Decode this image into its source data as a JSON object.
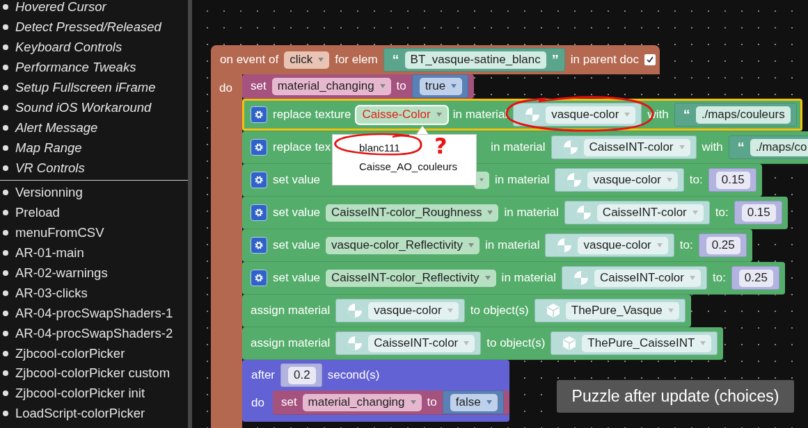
{
  "sidebar": {
    "groups": [
      {
        "items": [
          "Hovered Cursor",
          "Detect Pressed/Released",
          "Keyboard Controls",
          "Performance Tweaks",
          "Setup Fullscreen iFrame",
          "Sound iOS Workaround",
          "Alert Message",
          "Map Range",
          "VR Controls"
        ]
      },
      {
        "items": [
          "Versionning",
          "Preload",
          "menuFromCSV",
          "AR-01-main",
          "AR-02-warnings",
          "AR-03-clicks",
          "AR-04-procSwapShaders-1",
          "AR-04-procSwapShaders-2",
          "Zjbcool-colorPicker",
          "Zjbcool-colorPicker custom",
          "Zjbcool-colorPicker init",
          "LoadScript-colorPicker"
        ]
      }
    ]
  },
  "workspace": {
    "event": {
      "parts": [
        {
          "kind": "label",
          "text": "on event of"
        },
        {
          "kind": "dropdown",
          "text": "click"
        },
        {
          "kind": "label",
          "text": "for elem"
        },
        {
          "kind": "string",
          "open": "“",
          "text": "BT_vasque-satine_blanc",
          "close": "”"
        },
        {
          "kind": "label",
          "text": "in parent doc"
        },
        {
          "kind": "checkbox",
          "checked": true
        }
      ],
      "do_label": "do",
      "statements": [
        {
          "kind": "variable",
          "selected": false,
          "parts": [
            {
              "kind": "label",
              "text": "set"
            },
            {
              "kind": "dropdown",
              "text": "material_changing"
            },
            {
              "kind": "label",
              "text": "to"
            },
            {
              "kind": "bool",
              "text": "true"
            }
          ]
        },
        {
          "kind": "action",
          "selected": true,
          "parts": [
            {
              "kind": "label",
              "text": "replace texture"
            },
            {
              "kind": "dropdown",
              "text": "Caisse-Color",
              "invalid": true
            },
            {
              "kind": "label",
              "text": "in material"
            },
            {
              "kind": "material",
              "text": "vasque-color"
            },
            {
              "kind": "label",
              "text": "with"
            },
            {
              "kind": "string",
              "open": "“",
              "text": "./maps/couleurs"
            }
          ]
        },
        {
          "kind": "action",
          "selected": false,
          "parts": [
            {
              "kind": "label",
              "text": "replace tex"
            },
            {
              "kind": "covered"
            },
            {
              "kind": "label",
              "text": "in material"
            },
            {
              "kind": "material",
              "text": "CaisseINT-color"
            },
            {
              "kind": "label",
              "text": "with"
            },
            {
              "kind": "string",
              "open": "“",
              "text": "./maps/co"
            }
          ]
        },
        {
          "kind": "action",
          "selected": false,
          "parts": [
            {
              "kind": "label",
              "text": "set value"
            },
            {
              "kind": "dropdown"
            },
            {
              "kind": "label",
              "text": "in material"
            },
            {
              "kind": "material",
              "text": "vasque-color"
            },
            {
              "kind": "label",
              "text": "to:"
            },
            {
              "kind": "number",
              "text": "0.15"
            }
          ]
        },
        {
          "kind": "action",
          "selected": false,
          "parts": [
            {
              "kind": "label",
              "text": "set value"
            },
            {
              "kind": "dropdown",
              "text": "CaisseINT-color_Roughness"
            },
            {
              "kind": "label",
              "text": "in material"
            },
            {
              "kind": "material",
              "text": "CaisseINT-color"
            },
            {
              "kind": "label",
              "text": "to:"
            },
            {
              "kind": "number",
              "text": "0.15"
            }
          ]
        },
        {
          "kind": "action",
          "selected": false,
          "parts": [
            {
              "kind": "label",
              "text": "set value"
            },
            {
              "kind": "dropdown",
              "text": "vasque-color_Reflectivity"
            },
            {
              "kind": "label",
              "text": "in material"
            },
            {
              "kind": "material",
              "text": "vasque-color"
            },
            {
              "kind": "label",
              "text": "to:"
            },
            {
              "kind": "number",
              "text": "0.25"
            }
          ]
        },
        {
          "kind": "action",
          "selected": false,
          "parts": [
            {
              "kind": "label",
              "text": "set value"
            },
            {
              "kind": "dropdown",
              "text": "CaisseINT-color_Reflectivity"
            },
            {
              "kind": "label",
              "text": "in material"
            },
            {
              "kind": "material",
              "text": "CaisseINT-color"
            },
            {
              "kind": "label",
              "text": "to:"
            },
            {
              "kind": "number",
              "text": "0.25"
            }
          ]
        },
        {
          "kind": "assign",
          "selected": false,
          "parts": [
            {
              "kind": "label",
              "text": "assign material"
            },
            {
              "kind": "material",
              "text": "vasque-color"
            },
            {
              "kind": "label",
              "text": "to object(s)"
            },
            {
              "kind": "object",
              "text": "ThePure_Vasque"
            }
          ]
        },
        {
          "kind": "assign",
          "selected": false,
          "parts": [
            {
              "kind": "label",
              "text": "assign material"
            },
            {
              "kind": "material",
              "text": "CaisseINT-color"
            },
            {
              "kind": "label",
              "text": "to object(s)"
            },
            {
              "kind": "object",
              "text": "ThePure_CaisseINT"
            }
          ]
        },
        {
          "kind": "timer",
          "selected": false,
          "parts": [
            {
              "kind": "label",
              "text": "after"
            },
            {
              "kind": "number",
              "text": "0.2"
            },
            {
              "kind": "label",
              "text": "second(s)"
            }
          ],
          "do_label": "do",
          "inner": {
            "kind": "variable",
            "parts": [
              {
                "kind": "label",
                "text": "set"
              },
              {
                "kind": "dropdown",
                "text": "material_changing"
              },
              {
                "kind": "label",
                "text": "to"
              },
              {
                "kind": "bool",
                "text": "false"
              }
            ]
          }
        }
      ]
    },
    "dropdown_menu": {
      "options": [
        {
          "label": "blanc111",
          "selected": false
        },
        {
          "label": "Caisse_AO_couleurs",
          "selected": false
        }
      ]
    },
    "annotation_mark": "?",
    "caption": "Puzzle after update (choices)"
  }
}
